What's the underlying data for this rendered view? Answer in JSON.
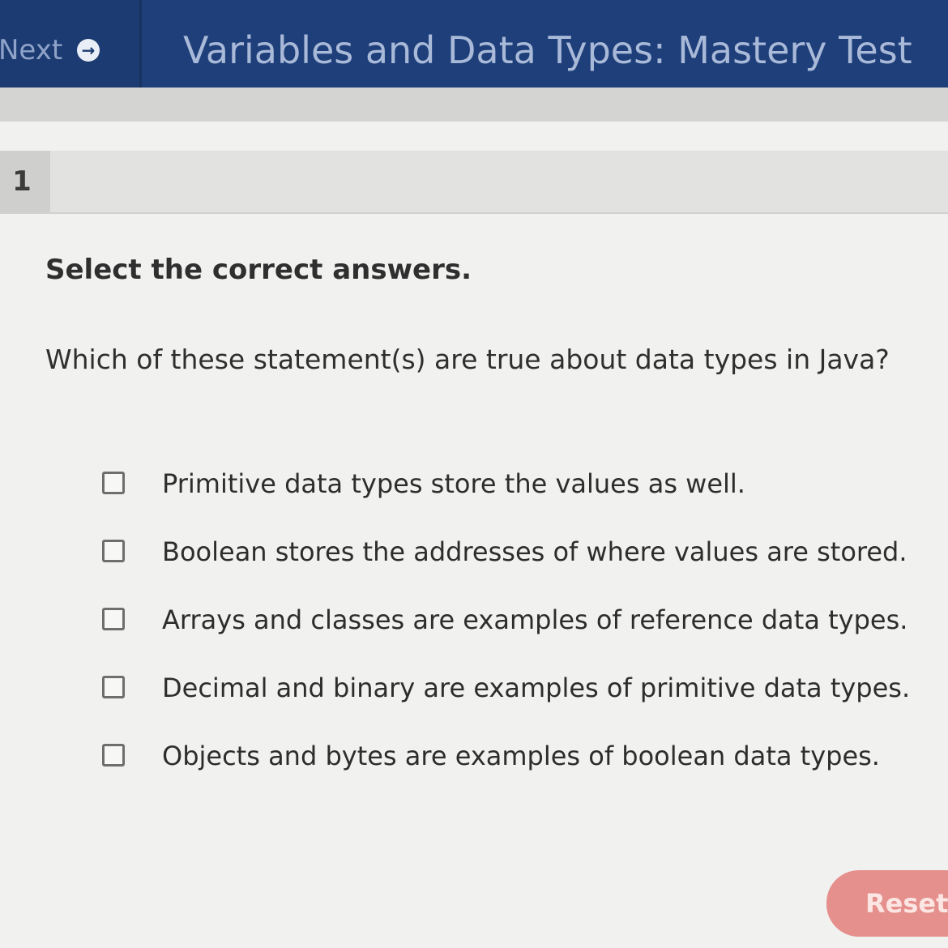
{
  "header": {
    "next_label": "Next",
    "title": "Variables and Data Types: Mastery Test"
  },
  "question": {
    "number": "1",
    "instruction": "Select the correct answers.",
    "prompt": "Which of these statement(s) are true about data types in Java?",
    "options": [
      {
        "label": "Primitive data types store the values as well.",
        "checked": false
      },
      {
        "label": "Boolean stores the addresses of where values are stored.",
        "checked": false
      },
      {
        "label": "Arrays and classes are examples of reference data types.",
        "checked": false
      },
      {
        "label": "Decimal and binary are examples of primitive data types.",
        "checked": false
      },
      {
        "label": "Objects and bytes are examples of boolean data types.",
        "checked": false
      }
    ]
  },
  "footer": {
    "reset_label": "Reset"
  },
  "colors": {
    "header_bg": "#1e3f7a",
    "reset_bg": "#e5908c"
  },
  "icons": {
    "next": "arrow-right-circle-icon"
  }
}
